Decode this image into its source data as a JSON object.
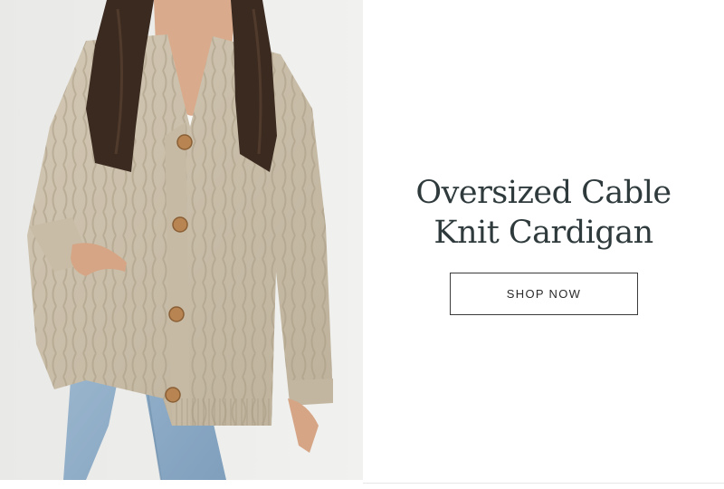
{
  "banner": {
    "image_alt": "Model wearing an oversized beige cable knit cardigan with light blue jeans",
    "headline_line1": "Oversized Cable",
    "headline_line2": "Knit Cardigan",
    "cta_label": "SHOP NOW"
  },
  "colors": {
    "headline": "#2f3a3c",
    "button_border": "#3b3b3b",
    "background": "#ffffff",
    "photo_background": "#eeeeec",
    "cardigan": "#cbbfa9",
    "jeans": "#93b1cb",
    "hair": "#3b2a20"
  }
}
